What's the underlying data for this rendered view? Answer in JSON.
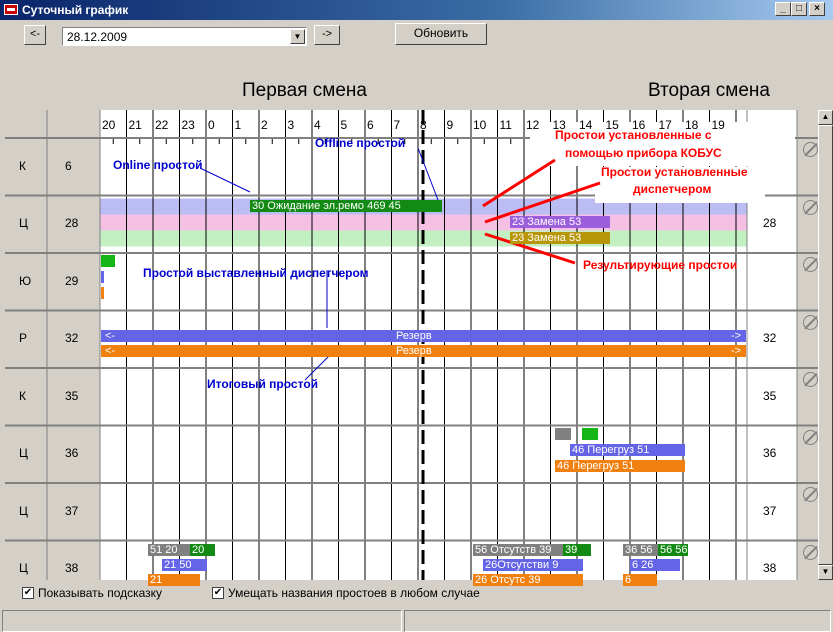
{
  "window": {
    "title": "Суточный график"
  },
  "toolbar": {
    "prev_label": "<-",
    "date": "28.12.2009",
    "next_label": "->",
    "refresh_label": "Обновить"
  },
  "shifts": {
    "first": "Первая смена",
    "second": "Вторая смена"
  },
  "hours": [
    "20",
    "21",
    "22",
    "23",
    "0",
    "1",
    "2",
    "3",
    "4",
    "5",
    "6",
    "7",
    "8",
    "9",
    "10",
    "11",
    "12",
    "13",
    "14",
    "15",
    "16",
    "17",
    "18",
    "19"
  ],
  "rows": [
    {
      "type": "К",
      "num": "6",
      "right_num": ""
    },
    {
      "type": "Ц",
      "num": "28",
      "right_num": "28"
    },
    {
      "type": "Ю",
      "num": "29",
      "right_num": ""
    },
    {
      "type": "Р",
      "num": "32",
      "right_num": "32"
    },
    {
      "type": "К",
      "num": "35",
      "right_num": "35"
    },
    {
      "type": "Ц",
      "num": "36",
      "right_num": "36"
    },
    {
      "type": "Ц",
      "num": "37",
      "right_num": "37"
    },
    {
      "type": "Ц",
      "num": "38",
      "right_num": "38"
    }
  ],
  "bars": {
    "r28_main": "30 Ожидание эл.ремо 469 45",
    "r28_purple": "23 Замена  53",
    "r28_olive": "23 Замена  53",
    "r32_blue": "Резерв",
    "r32_orange": "Резерв",
    "r32_left": "<-",
    "r32_right": "->",
    "r36_blue": "46 Перегруз  51",
    "r36_orange": "46 Перегруз  51",
    "r38_g1": "51  20",
    "r38_g1b": "20",
    "r38_b1": "21  50",
    "r38_o1": "21",
    "r38_g2": "56 Отсутств 39",
    "r38_g2b": "39",
    "r38_b2": "26Отсутстви  9",
    "r38_o2": "26 Отсутс 39",
    "r38_g3": "36 56",
    "r38_g3b": "56 56",
    "r38_b3": "6  26",
    "r38_o3": "6"
  },
  "annotations": {
    "online": "Online простой",
    "offline": "Offline простой",
    "kobus_1": "Простои установленные с",
    "kobus_2": "помощью прибора КОБУС",
    "disp_1": "Простои установленные",
    "disp_2": "диспетчером",
    "result": "Результирующие простои",
    "set_by_disp": "Простой выставленный диспетчером",
    "final": "Итоговый простой"
  },
  "options": {
    "show_hint": "Показывать подсказку",
    "fit_names": "Умещать названия простоев в любом случае"
  },
  "colors": {
    "blue_bar": "#6464e6",
    "orange_bar": "#f08010",
    "green_bar": "#138a13",
    "olive": "#b8960a",
    "purple": "#9b5fdc",
    "gray": "#808080",
    "bright_green": "#16b516",
    "row_lavender": "#bcbcf4",
    "row_pink": "#f5c0e4",
    "row_mint": "#c2f0c2"
  }
}
